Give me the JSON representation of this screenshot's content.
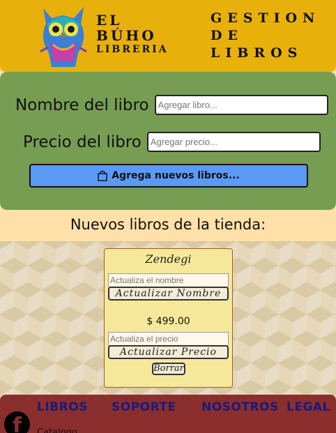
{
  "header": {
    "brand": {
      "line1": "EL",
      "line2": "BÚHO",
      "line3": "LIBRERIA"
    },
    "title_lines": [
      "GESTION",
      "DE",
      "LIBROS"
    ],
    "logo_icon": "owl-logo"
  },
  "form": {
    "name_label": "Nombre del libro",
    "name_placeholder": "Agregar libro...",
    "price_label": "Precio del libro",
    "price_placeholder": "Agregar precio...",
    "add_button_label": "Agrega nuevos libros...",
    "add_button_icon": "shopping-bag-icon"
  },
  "section_title": "Nuevos libros de la tienda:",
  "books": [
    {
      "name": "Zendegi",
      "name_input_placeholder": "Actualiza el nombre",
      "update_name_label": "Actualizar Nombre",
      "price": "$ 499.00",
      "price_input_placeholder": "Actualiza el precio",
      "update_price_label": "Actualizar Precio",
      "delete_label": "Borrar"
    }
  ],
  "footer": {
    "nav": [
      "LIBROS",
      "SOPORTE",
      "NOSOTROS",
      "LEGAL"
    ],
    "sub_link": "Catalogo",
    "social_icon": "facebook-icon"
  },
  "colors": {
    "header_bg": "#e8b00a",
    "form_bg": "#779d53",
    "add_button_bg": "#5a9af5",
    "card_bg": "#f6e89a",
    "footer_bg": "#8a2e2e",
    "footer_link": "#1a1a7a"
  }
}
